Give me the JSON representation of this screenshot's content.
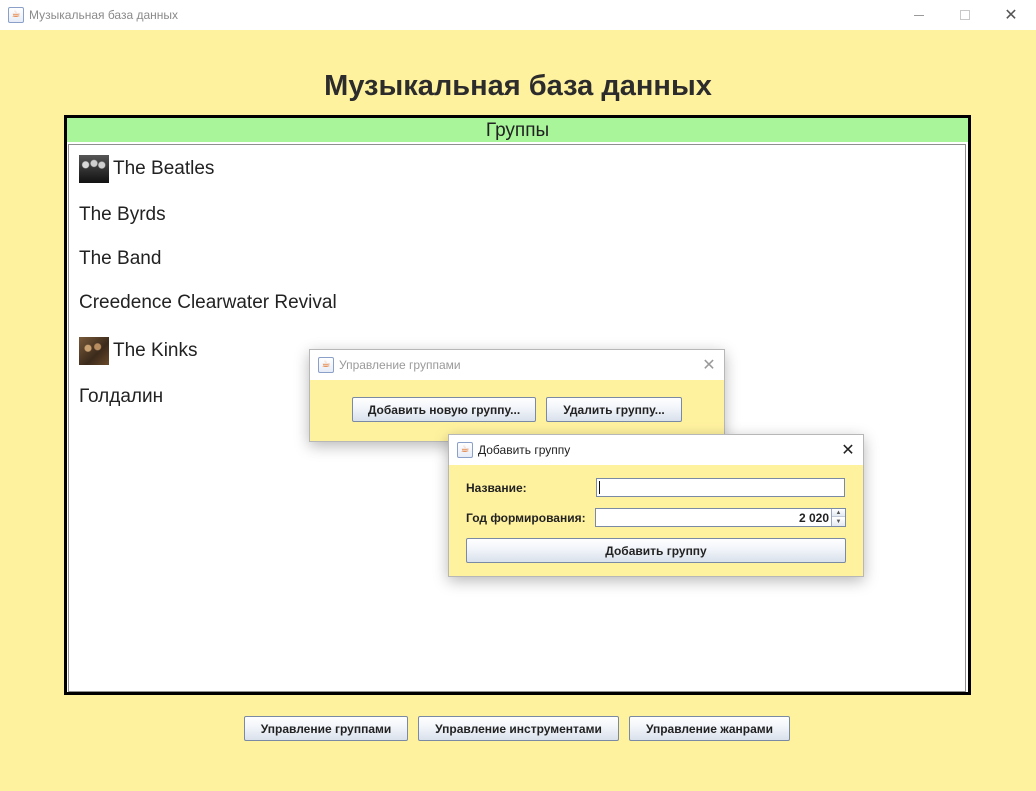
{
  "window": {
    "title": "Музыкальная база данных",
    "icon": "java-cup-icon",
    "controls": {
      "minimize": "minimize-icon",
      "maximize": "maximize-icon",
      "close": "close-icon"
    }
  },
  "heading": "Музыкальная база данных",
  "groups_panel": {
    "header": "Группы",
    "items": [
      {
        "name": "The Beatles",
        "thumbnail": "band-photo"
      },
      {
        "name": "The Byrds"
      },
      {
        "name": "The Band"
      },
      {
        "name": "Creedence Clearwater Revival"
      },
      {
        "name": "The Kinks",
        "thumbnail": "band-photo"
      },
      {
        "name": "Голдалин"
      }
    ]
  },
  "dialog_manage_groups": {
    "title": "Управление группами",
    "add_button": "Добавить новую группу...",
    "delete_button": "Удалить группу..."
  },
  "dialog_add_group": {
    "title": "Добавить группу",
    "name_label": "Название:",
    "name_value": "",
    "year_label": "Год формирования:",
    "year_value": "2 020",
    "submit_button": "Добавить группу"
  },
  "bottom_toolbar": {
    "groups_button": "Управление группами",
    "instruments_button": "Управление инструментами",
    "genres_button": "Управление жанрами"
  },
  "colors": {
    "background": "#fff29f",
    "groups_header": "#a8f59a",
    "panel_border": "#000000"
  }
}
